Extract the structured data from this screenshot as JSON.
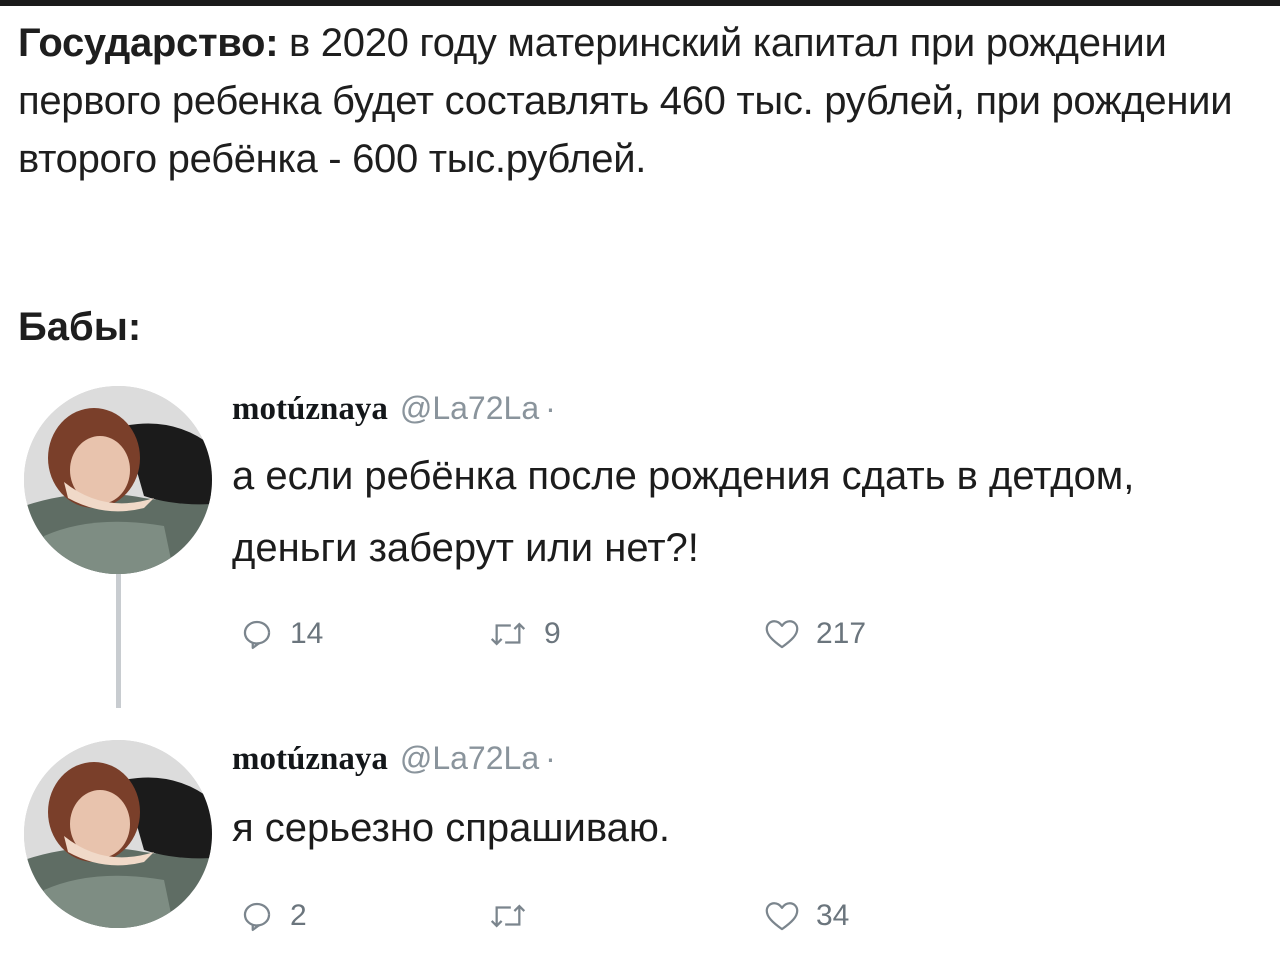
{
  "intro": {
    "lead": "Государство:",
    "body": " в 2020 году материнский капитал при рождении первого ребенка будет составлять 460 тыс. рублей, при рождении второго ребёнка - 600 тыс.рублей.",
    "reply_lead": "Бабы:"
  },
  "tweets": [
    {
      "author_name": "motúznaya",
      "handle": "@La72La",
      "separator": "·",
      "text": "а если ребёнка после рождения сдать в детдом, деньги заберут или нет?!",
      "reply_count": "14",
      "retweet_count": "9",
      "like_count": "217"
    },
    {
      "author_name": "motúznaya",
      "handle": "@La72La",
      "separator": "·",
      "text": "я серьезно спрашиваю.",
      "reply_count": "2",
      "retweet_count": "",
      "like_count": "34"
    }
  ],
  "icons": {
    "reply": "reply-icon",
    "retweet": "retweet-icon",
    "like": "heart-icon",
    "avatar": "avatar"
  },
  "colors": {
    "text": "#1c1c1c",
    "muted": "#6b757d",
    "thread_line": "#c8ccd0"
  }
}
